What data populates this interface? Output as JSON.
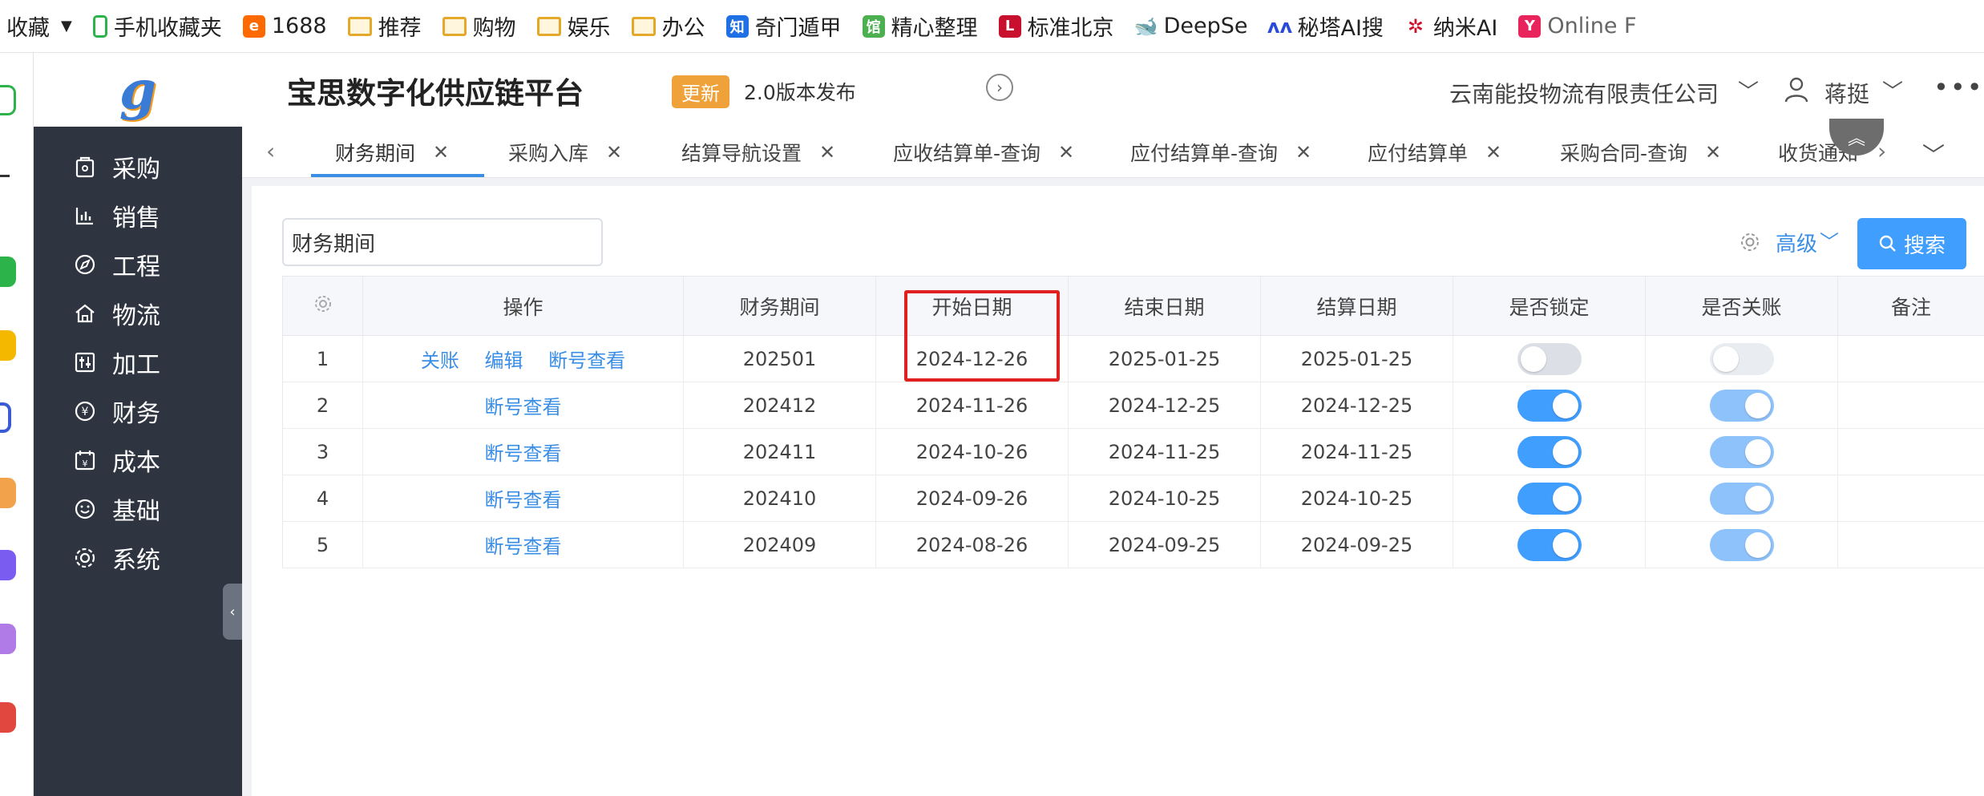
{
  "bookmarks": [
    {
      "label": "收藏",
      "icon": "favorites-chevron-icon"
    },
    {
      "label": "手机收藏夹",
      "icon": "phone-icon"
    },
    {
      "label": "1688",
      "icon": "1688-icon"
    },
    {
      "label": "推荐",
      "icon": "folder-icon"
    },
    {
      "label": "购物",
      "icon": "folder-icon"
    },
    {
      "label": "娱乐",
      "icon": "folder-icon"
    },
    {
      "label": "办公",
      "icon": "folder-icon"
    },
    {
      "label": "奇门遁甲",
      "icon": "zhi-icon"
    },
    {
      "label": "精心整理",
      "icon": "guan-icon"
    },
    {
      "label": "标准北京",
      "icon": "l-icon"
    },
    {
      "label": "DeepSe",
      "icon": "deepseek-icon"
    },
    {
      "label": "秘塔AI搜",
      "icon": "metaso-icon"
    },
    {
      "label": "纳米AI",
      "icon": "nami-icon"
    },
    {
      "label": "Online F",
      "icon": "online-icon"
    }
  ],
  "header": {
    "logo_text": "g",
    "app_title": "宝思数字化供应链平台",
    "update_badge": "更新",
    "release_text": "2.0版本发布",
    "company": "云南能投物流有限责任公司",
    "user": "蒋挺",
    "more": "•••"
  },
  "sidebar": {
    "items": [
      {
        "label": "采购",
        "icon": "purchase-icon"
      },
      {
        "label": "销售",
        "icon": "sales-chart-icon"
      },
      {
        "label": "工程",
        "icon": "compass-icon"
      },
      {
        "label": "物流",
        "icon": "home-icon"
      },
      {
        "label": "加工",
        "icon": "sliders-icon"
      },
      {
        "label": "财务",
        "icon": "yen-icon"
      },
      {
        "label": "成本",
        "icon": "calendar-icon"
      },
      {
        "label": "基础",
        "icon": "smile-icon"
      },
      {
        "label": "系统",
        "icon": "gear-icon"
      }
    ]
  },
  "tabs": [
    {
      "label": "财务期间",
      "active": true
    },
    {
      "label": "采购入库"
    },
    {
      "label": "结算导航设置"
    },
    {
      "label": "应收结算单-查询"
    },
    {
      "label": "应付结算单-查询"
    },
    {
      "label": "应付结算单"
    },
    {
      "label": "采购合同-查询"
    },
    {
      "label": "收货通知"
    }
  ],
  "toolbar": {
    "search_value": "财务期间",
    "advanced_label": "高级",
    "search_button": "搜索"
  },
  "table": {
    "columns": [
      "操作",
      "财务期间",
      "开始日期",
      "结束日期",
      "结算日期",
      "是否锁定",
      "是否关账",
      "备注"
    ],
    "rows": [
      {
        "index": "1",
        "actions": [
          "关账",
          "编辑",
          "断号查看"
        ],
        "period": "202501",
        "start": "2024-12-26",
        "end": "2025-01-25",
        "settle": "2025-01-25",
        "locked": false,
        "closed": false
      },
      {
        "index": "2",
        "actions": [
          "断号查看"
        ],
        "period": "202412",
        "start": "2024-11-26",
        "end": "2024-12-25",
        "settle": "2024-12-25",
        "locked": true,
        "closed": true
      },
      {
        "index": "3",
        "actions": [
          "断号查看"
        ],
        "period": "202411",
        "start": "2024-10-26",
        "end": "2024-11-25",
        "settle": "2024-11-25",
        "locked": true,
        "closed": true
      },
      {
        "index": "4",
        "actions": [
          "断号查看"
        ],
        "period": "202410",
        "start": "2024-09-26",
        "end": "2024-10-25",
        "settle": "2024-10-25",
        "locked": true,
        "closed": true
      },
      {
        "index": "5",
        "actions": [
          "断号查看"
        ],
        "period": "202409",
        "start": "2024-08-26",
        "end": "2024-09-25",
        "settle": "2024-09-25",
        "locked": true,
        "closed": true
      }
    ]
  },
  "colors": {
    "accent": "#409eff",
    "sidebar_bg": "#2e3440",
    "badge": "#f0a23a",
    "highlight": "#e02020"
  }
}
